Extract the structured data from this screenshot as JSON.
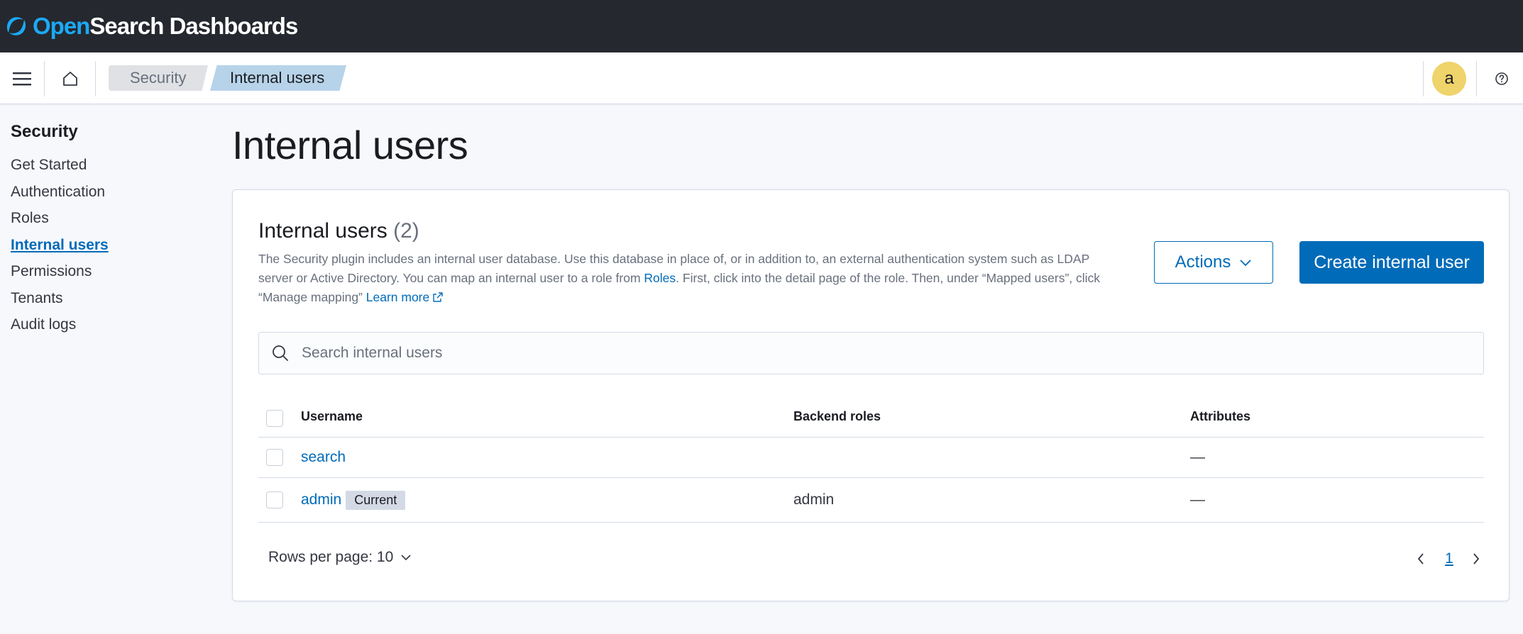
{
  "app": {
    "logo_open": "Open",
    "logo_rest": "Search Dashboards"
  },
  "header": {
    "breadcrumbs": [
      "Security",
      "Internal users"
    ],
    "avatar_initial": "a"
  },
  "sidebar": {
    "title": "Security",
    "items": [
      {
        "label": "Get Started"
      },
      {
        "label": "Authentication"
      },
      {
        "label": "Roles"
      },
      {
        "label": "Internal users",
        "active": true
      },
      {
        "label": "Permissions"
      },
      {
        "label": "Tenants"
      },
      {
        "label": "Audit logs"
      }
    ]
  },
  "main": {
    "page_title": "Internal users",
    "panel": {
      "title": "Internal users",
      "count": "(2)",
      "desc_part1": "The Security plugin includes an internal user database. Use this database in place of, or in addition to, an external authentication system such as LDAP server or Active Directory. You can map an internal user to a role from ",
      "desc_roles_link": "Roles",
      "desc_part2": ". First, click into the detail page of the role. Then, under “Mapped users”, click “Manage mapping” ",
      "learn_more": "Learn more",
      "actions_label": "Actions",
      "create_label": "Create internal user",
      "search_placeholder": "Search internal users"
    },
    "table": {
      "columns": [
        "Username",
        "Backend roles",
        "Attributes"
      ],
      "rows": [
        {
          "username": "search",
          "badge": "",
          "backend_roles": "",
          "attributes": "—"
        },
        {
          "username": "admin",
          "badge": "Current",
          "backend_roles": "admin",
          "attributes": "—"
        }
      ]
    },
    "pagination": {
      "rows_per_page": "Rows per page: 10",
      "current_page": "1"
    }
  },
  "colors": {
    "accent": "#006bb8",
    "topbar": "#25282f",
    "avatar": "#efd36b"
  }
}
